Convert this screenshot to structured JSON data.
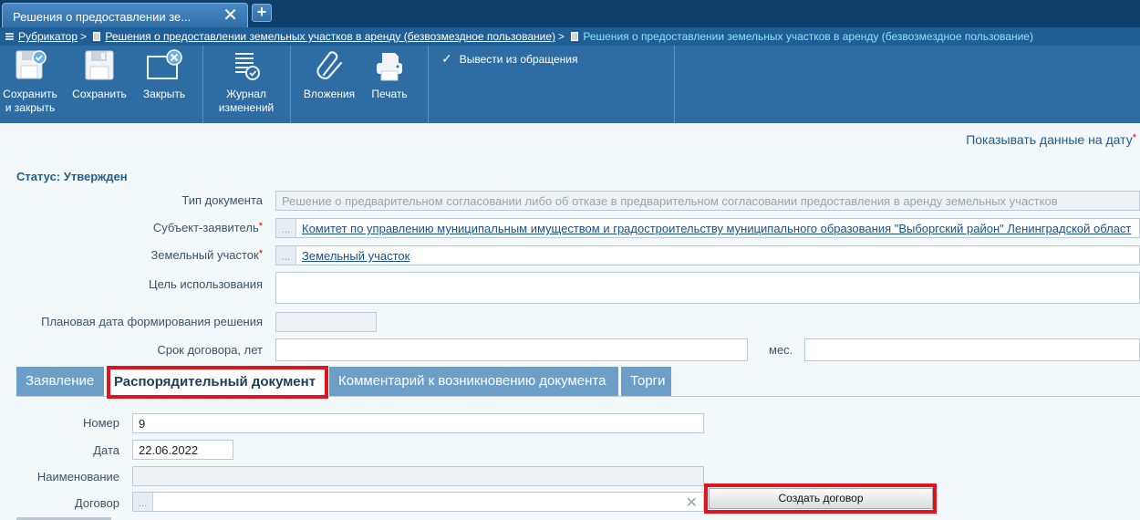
{
  "window_tab": {
    "title": "Решения о предоставлении зе...",
    "close_glyph": "✕",
    "new_tab_glyph": "+"
  },
  "breadcrumb": {
    "items": [
      {
        "label": "Рубрикатор",
        "link": true
      },
      {
        "label": "Решения о предоставлении земельных участков в аренду (безвозмездное пользование)",
        "link": true
      },
      {
        "label": "Решения о предоставлении земельных участков в аренду (безвозмездное пользование)",
        "link": false
      }
    ],
    "separator": ">"
  },
  "toolbar": {
    "save_close": {
      "label_line1": "Сохранить",
      "label_line2": "и закрыть",
      "icon": "save-check-icon"
    },
    "save": {
      "label": "Сохранить",
      "icon": "floppy-disk-icon"
    },
    "close": {
      "label": "Закрыть",
      "icon": "window-close-icon"
    },
    "journal": {
      "label_line1": "Журнал",
      "label_line2": "изменений",
      "icon": "change-journal-icon"
    },
    "attachments": {
      "label": "Вложения",
      "icon": "paperclip-icon"
    },
    "print": {
      "label": "Печать",
      "icon": "printer-icon"
    },
    "withdraw": {
      "label": "Вывести из обращения",
      "checked": true
    }
  },
  "form": {
    "show_date_label": "Показывать данные на дату",
    "status": "Статус: Утвержден",
    "doc_type": {
      "label": "Тип документа",
      "value": "Решение о предварительном согласовании либо об отказе в предварительном согласовании предоставления в аренду земельных участков"
    },
    "applicant": {
      "label": "Субъект-заявитель",
      "value": "Комитет по управлению муниципальным имуществом и градостроительству муниципального образования \"Выборгский район\" Ленинградской област"
    },
    "land_plot": {
      "label": "Земельный участок",
      "value": "Земельный участок"
    },
    "purpose": {
      "label": "Цель использования",
      "value": ""
    },
    "planned_date": {
      "label": "Плановая дата формирования решения",
      "value": ""
    },
    "term": {
      "label": "Срок договора, лет",
      "value": "",
      "months_label": "мес.",
      "months_value": ""
    },
    "ref_dots": "..."
  },
  "tabs": [
    {
      "label": "Заявление",
      "active": false
    },
    {
      "label": "Распорядительный документ",
      "active": true
    },
    {
      "label": "Комментарий к возникновению документа",
      "active": false
    },
    {
      "label": "Торги",
      "active": false
    }
  ],
  "order_doc": {
    "number": {
      "label": "Номер",
      "value": "9"
    },
    "date": {
      "label": "Дата",
      "value": "22.06.2022"
    },
    "name": {
      "label": "Наименование",
      "value": ""
    },
    "contract": {
      "label": "Договор",
      "value": "",
      "clear_glyph": "✕"
    },
    "create_contract_button": "Создать договор"
  },
  "colors": {
    "accent": "#2e6da4",
    "highlight": "#e0141e",
    "link": "#1a4f8a"
  }
}
